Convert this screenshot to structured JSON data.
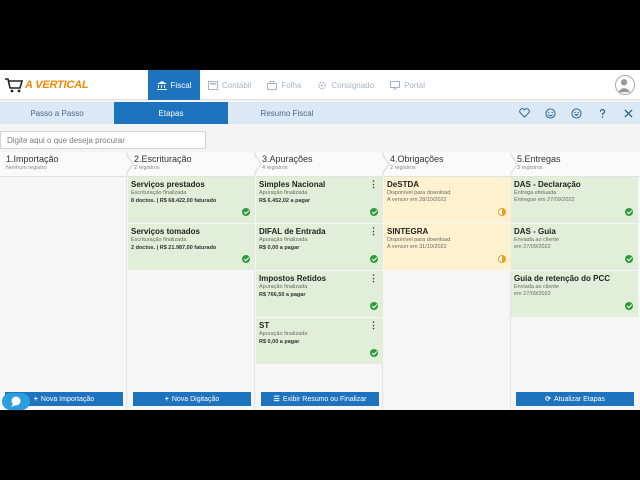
{
  "app": {
    "logo_text": "A VERTICAL"
  },
  "nav": {
    "items": [
      {
        "label": "Fiscal",
        "active": true,
        "icon": "bank-icon"
      },
      {
        "label": "Contábil",
        "active": false,
        "icon": "calculator-icon"
      },
      {
        "label": "Folha",
        "active": false,
        "icon": "briefcase-icon"
      },
      {
        "label": "Consignado",
        "active": false,
        "icon": "gear-icon"
      },
      {
        "label": "Portal",
        "active": false,
        "icon": "monitor-icon"
      }
    ]
  },
  "subbar": {
    "tabs": [
      {
        "label": "Passo a Passo",
        "active": false
      },
      {
        "label": "Etapas",
        "active": true
      },
      {
        "label": "Resumo Fiscal",
        "active": false
      }
    ]
  },
  "search": {
    "placeholder": "Digite aqui o que deseja procurar"
  },
  "columns": [
    {
      "title": "1.Importação",
      "count": "Nenhum registro",
      "cards": [],
      "button": "Nova Importação"
    },
    {
      "title": "2.Escrituração",
      "count": "2 registros",
      "cards": [
        {
          "title": "Serviços prestados",
          "sub": "Escrituração finalizada",
          "info": "8 doctos. | R$ 68.422,00 faturado",
          "status": "ok"
        },
        {
          "title": "Serviços tomados",
          "sub": "Escrituração finalizada",
          "info": "2 doctos. | R$ 21.987,00 faturado",
          "status": "ok"
        }
      ],
      "button": "Nova Digitação"
    },
    {
      "title": "3.Apurações",
      "count": "4 registros",
      "cards": [
        {
          "title": "Simples Nacional",
          "sub": "Apuração finalizada",
          "info": "R$ 6.452,02 a pagar",
          "status": "ok"
        },
        {
          "title": "DIFAL de Entrada",
          "sub": "Apuração finalizada",
          "info": "R$ 0,00 a pagar",
          "status": "ok"
        },
        {
          "title": "Impostos Retidos",
          "sub": "Apuração finalizada",
          "info": "R$ 766,50 a pagar",
          "status": "ok"
        },
        {
          "title": "ST",
          "sub": "Apuração finalizada",
          "info": "R$ 0,00 a pagar",
          "status": "ok"
        }
      ],
      "button": "Exibir Resumo ou Finalizar"
    },
    {
      "title": "4.Obrigações",
      "count": "2 registros",
      "cards": [
        {
          "title": "DeSTDA",
          "sub": "Disponível para download",
          "info": "A vencer em 28/10/2022",
          "status": "half"
        },
        {
          "title": "SINTEGRA",
          "sub": "Disponível para download",
          "info": "A vencer em 31/10/2022",
          "status": "half"
        }
      ],
      "button": ""
    },
    {
      "title": "5.Entregas",
      "count": "3 registros",
      "cards": [
        {
          "title": "DAS - Declaração",
          "sub": "Entrega efetuada",
          "info": "Entregue em 27/09/2022",
          "status": "ok"
        },
        {
          "title": "DAS - Guia",
          "sub": "Enviada ao cliente",
          "info": "em 27/09/2022",
          "status": "ok"
        },
        {
          "title": "Guia de retenção do PCC",
          "sub": "Enviada ao cliente",
          "info": "em 27/09/2022",
          "status": "ok"
        }
      ],
      "button": "Atualizar Etapas"
    }
  ],
  "colors": {
    "primary": "#1e73be",
    "card_green": "#e1eed8",
    "card_yellow": "#fdf1cf",
    "status_ok": "#2e9a3b",
    "status_pending": "#e8a21c"
  }
}
